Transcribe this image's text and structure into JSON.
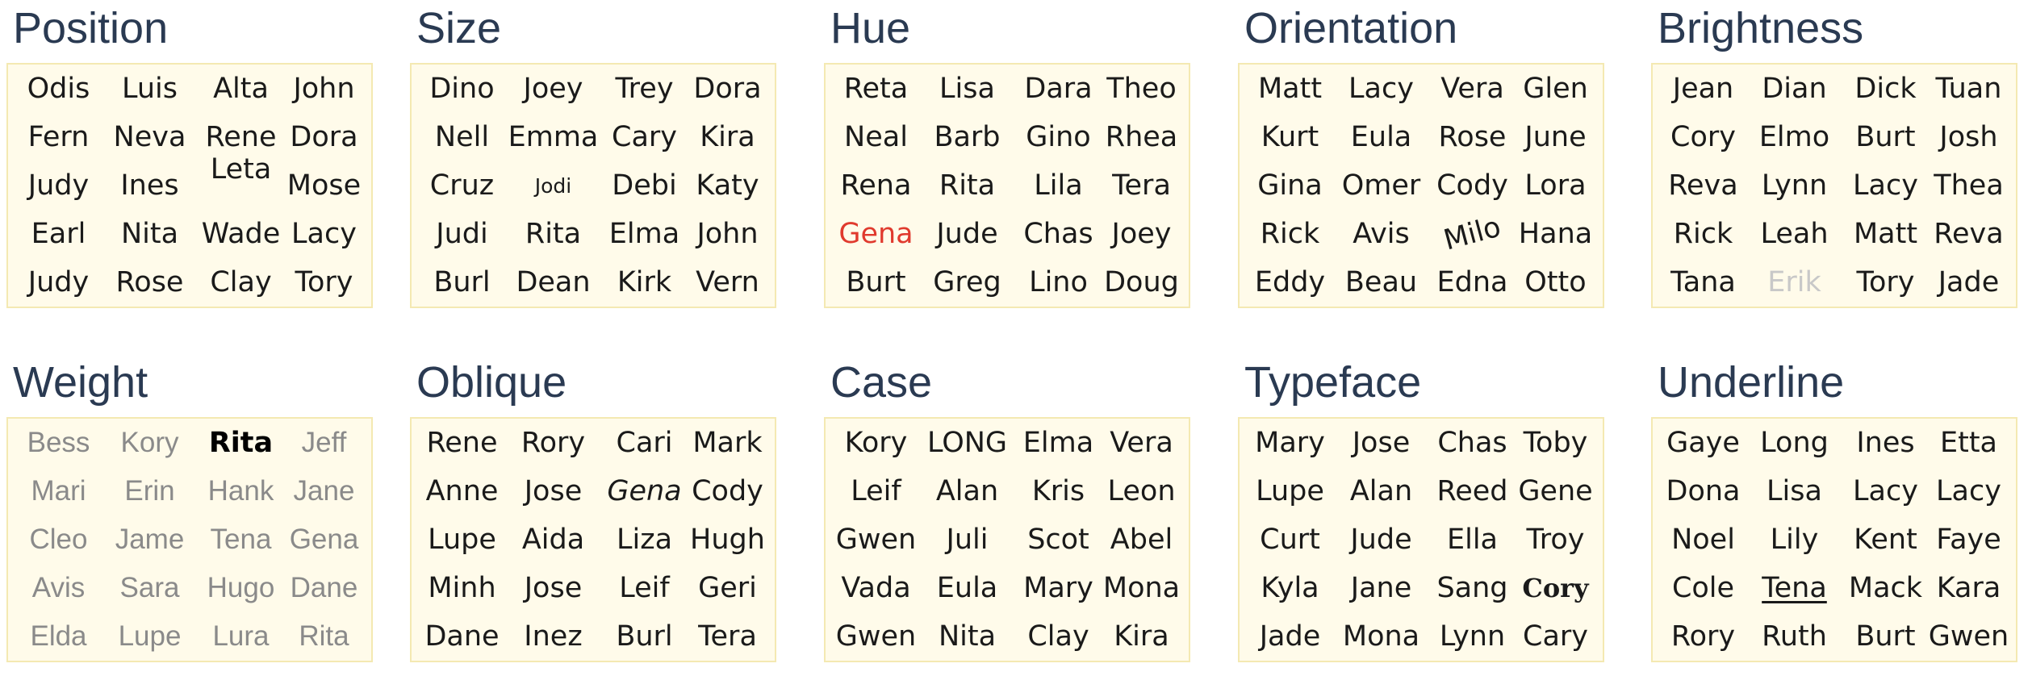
{
  "panels": [
    {
      "title": "Position",
      "names": [
        "Odis",
        "Luis",
        "Alta",
        "John",
        "Fern",
        "Neva",
        "Rene",
        "Dora",
        "Judy",
        "Ines",
        "Leta",
        "Mose",
        "Earl",
        "Nita",
        "Wade",
        "Lacy",
        "Judy",
        "Rose",
        "Clay",
        "Tory"
      ]
    },
    {
      "title": "Size",
      "names": [
        "Dino",
        "Joey",
        "Trey",
        "Dora",
        "Nell",
        "Emma",
        "Cary",
        "Kira",
        "Cruz",
        "Jodi",
        "Debi",
        "Katy",
        "Judi",
        "Rita",
        "Elma",
        "John",
        "Burl",
        "Dean",
        "Kirk",
        "Vern"
      ]
    },
    {
      "title": "Hue",
      "names": [
        "Reta",
        "Lisa",
        "Dara",
        "Theo",
        "Neal",
        "Barb",
        "Gino",
        "Rhea",
        "Rena",
        "Rita",
        "Lila",
        "Tera",
        "Gena",
        "Jude",
        "Chas",
        "Joey",
        "Burt",
        "Greg",
        "Lino",
        "Doug"
      ]
    },
    {
      "title": "Orientation",
      "names": [
        "Matt",
        "Lacy",
        "Vera",
        "Glen",
        "Kurt",
        "Eula",
        "Rose",
        "June",
        "Gina",
        "Omer",
        "Cody",
        "Lora",
        "Rick",
        "Avis",
        "Milo",
        "Hana",
        "Eddy",
        "Beau",
        "Edna",
        "Otto"
      ]
    },
    {
      "title": "Brightness",
      "names": [
        "Jean",
        "Dian",
        "Dick",
        "Tuan",
        "Cory",
        "Elmo",
        "Burt",
        "Josh",
        "Reva",
        "Lynn",
        "Lacy",
        "Thea",
        "Rick",
        "Leah",
        "Matt",
        "Reva",
        "Tana",
        "Erik",
        "Tory",
        "Jade"
      ]
    },
    {
      "title": "Weight",
      "names": [
        "Bess",
        "Kory",
        "Rita",
        "Jeff",
        "Mari",
        "Erin",
        "Hank",
        "Jane",
        "Cleo",
        "Jame",
        "Tena",
        "Gena",
        "Avis",
        "Sara",
        "Hugo",
        "Dane",
        "Elda",
        "Lupe",
        "Lura",
        "Rita"
      ]
    },
    {
      "title": "Oblique",
      "names": [
        "Rene",
        "Rory",
        "Cari",
        "Mark",
        "Anne",
        "Jose",
        "Gena",
        "Cody",
        "Lupe",
        "Aida",
        "Liza",
        "Hugh",
        "Minh",
        "Jose",
        "Leif",
        "Geri",
        "Dane",
        "Inez",
        "Burl",
        "Tera"
      ]
    },
    {
      "title": "Case",
      "names": [
        "Kory",
        "LONG",
        "Elma",
        "Vera",
        "Leif",
        "Alan",
        "Kris",
        "Leon",
        "Gwen",
        "Juli",
        "Scot",
        "Abel",
        "Vada",
        "Eula",
        "Mary",
        "Mona",
        "Gwen",
        "Nita",
        "Clay",
        "Kira"
      ]
    },
    {
      "title": "Typeface",
      "names": [
        "Mary",
        "Jose",
        "Chas",
        "Toby",
        "Lupe",
        "Alan",
        "Reed",
        "Gene",
        "Curt",
        "Jude",
        "Ella",
        "Troy",
        "Kyla",
        "Jane",
        "Sang",
        "Cory",
        "Jade",
        "Mona",
        "Lynn",
        "Cary"
      ]
    },
    {
      "title": "Underline",
      "names": [
        "Gaye",
        "Long",
        "Ines",
        "Etta",
        "Dona",
        "Lisa",
        "Lacy",
        "Lacy",
        "Noel",
        "Lily",
        "Kent",
        "Faye",
        "Cole",
        "Tena",
        "Mack",
        "Kara",
        "Rory",
        "Ruth",
        "Burt",
        "Gwen"
      ]
    }
  ],
  "colors": {
    "highlight_red": "#e03a2e",
    "faded_gray": "#c8c8c8",
    "title": "#2a3a52",
    "box_fill": "#fffbea",
    "box_border": "#f4e9b2"
  }
}
